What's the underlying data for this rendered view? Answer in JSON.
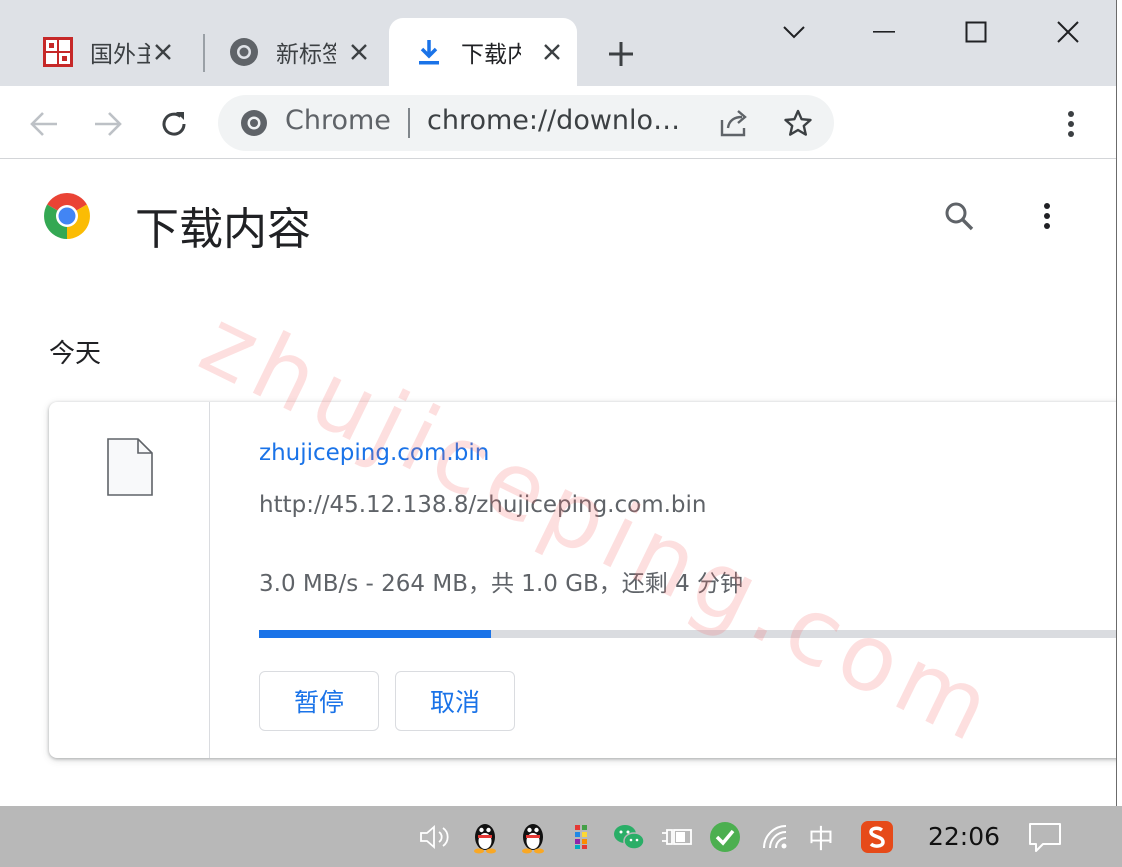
{
  "tabs": [
    {
      "title": "国外主"
    },
    {
      "title": "新标签"
    },
    {
      "title": "下载内"
    }
  ],
  "toolbar": {
    "omnibox_label": "Chrome",
    "url": "chrome://downloads"
  },
  "page": {
    "title": "下载内容",
    "date_heading": "今天"
  },
  "download": {
    "file_name": "zhujiceping.com.bin",
    "source_url": "http://45.12.138.8/zhujiceping.com.bin",
    "status": "3.0 MB/s - 264 MB，共 1.0 GB，还剩 4 分钟",
    "progress_fraction": 0.264,
    "pause_label": "暂停",
    "cancel_label": "取消"
  },
  "watermark": "zhujiceping.com",
  "taskbar": {
    "ime_label": "中",
    "clock": "22:06"
  },
  "colors": {
    "accent": "#1a73e8",
    "tabstrip": "#dee1e6",
    "taskbar": "#b8b8b8"
  }
}
